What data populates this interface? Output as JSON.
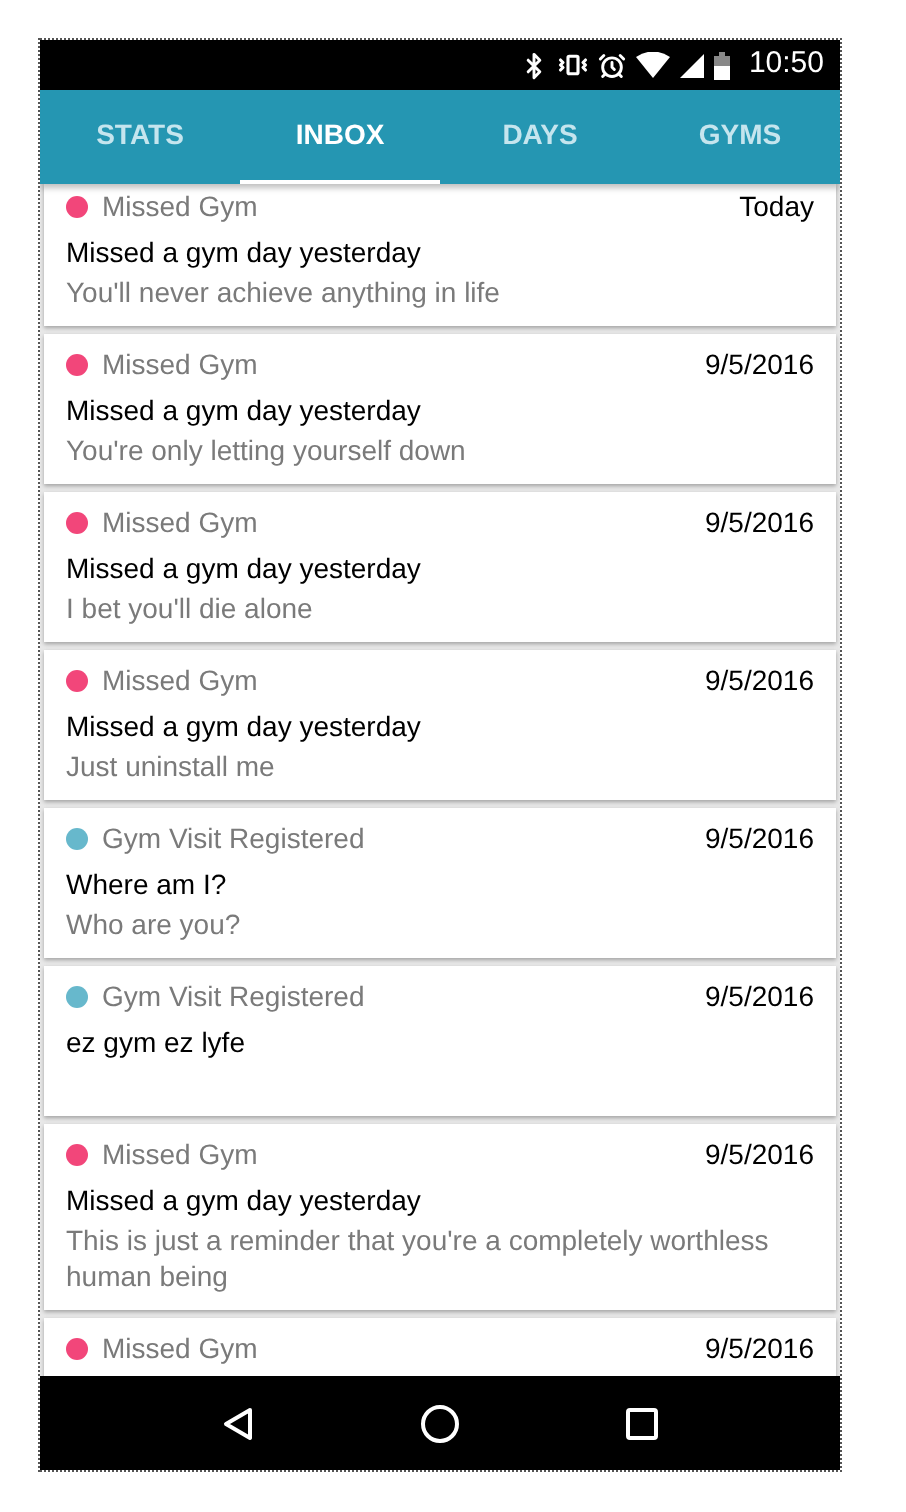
{
  "status_bar": {
    "time": "10:50"
  },
  "tabs": [
    {
      "label": "STATS",
      "selected": false
    },
    {
      "label": "INBOX",
      "selected": true
    },
    {
      "label": "DAYS",
      "selected": false
    },
    {
      "label": "GYMS",
      "selected": false
    }
  ],
  "messages": [
    {
      "category": "Missed Gym",
      "color": "#f2467a",
      "date": "Today",
      "title": "Missed a gym day yesterday",
      "body": "You'll never achieve anything in life"
    },
    {
      "category": "Missed Gym",
      "color": "#f2467a",
      "date": "9/5/2016",
      "title": "Missed a gym day yesterday",
      "body": "You're only letting yourself down"
    },
    {
      "category": "Missed Gym",
      "color": "#f2467a",
      "date": "9/5/2016",
      "title": "Missed a gym day yesterday",
      "body": "I bet you'll die alone"
    },
    {
      "category": "Missed Gym",
      "color": "#f2467a",
      "date": "9/5/2016",
      "title": "Missed a gym day yesterday",
      "body": "Just uninstall me"
    },
    {
      "category": "Gym Visit Registered",
      "color": "#67b8cc",
      "date": "9/5/2016",
      "title": "Where am I?",
      "body": "Who are you?"
    },
    {
      "category": "Gym Visit Registered",
      "color": "#67b8cc",
      "date": "9/5/2016",
      "title": "ez gym ez lyfe"
    },
    {
      "category": "Missed Gym",
      "color": "#f2467a",
      "date": "9/5/2016",
      "title": "Missed a gym day yesterday",
      "body": "This is just a reminder that you're a completely worthless human being"
    },
    {
      "category": "Missed Gym",
      "color": "#f2467a",
      "date": "9/5/2016"
    }
  ]
}
